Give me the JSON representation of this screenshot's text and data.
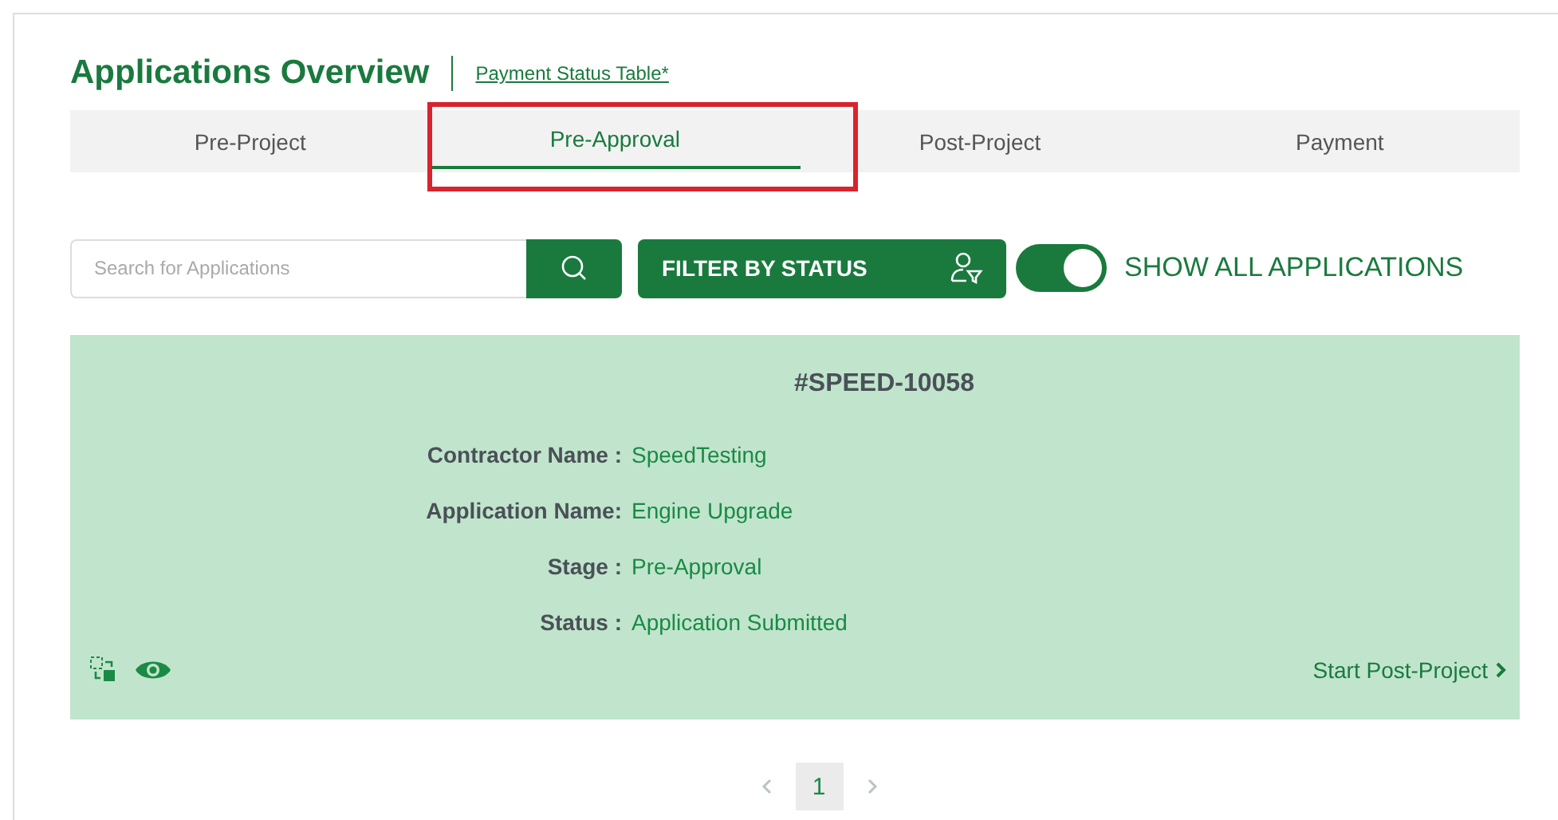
{
  "header": {
    "title": "Applications Overview",
    "link": "Payment Status Table*"
  },
  "tabs": [
    {
      "label": "Pre-Project",
      "selected": false,
      "highlighted": false
    },
    {
      "label": "Pre-Approval",
      "selected": true,
      "highlighted": true
    },
    {
      "label": "Post-Project",
      "selected": false,
      "highlighted": false
    },
    {
      "label": "Payment",
      "selected": false,
      "highlighted": false
    }
  ],
  "search": {
    "placeholder": "Search for Applications"
  },
  "filter_button": "FILTER BY STATUS",
  "show_all": {
    "label": "SHOW ALL APPLICATIONS",
    "on": true
  },
  "card": {
    "id": "#SPEED-10058",
    "fields": [
      {
        "label": "Contractor Name :",
        "value": "SpeedTesting"
      },
      {
        "label": "Application Name:",
        "value": "Engine Upgrade"
      },
      {
        "label": "Stage :",
        "value": "Pre-Approval"
      },
      {
        "label": "Status :",
        "value": "Application Submitted"
      }
    ],
    "action": "Start Post-Project"
  },
  "pagination": {
    "pages": [
      {
        "label": "1",
        "selected": true
      }
    ]
  }
}
